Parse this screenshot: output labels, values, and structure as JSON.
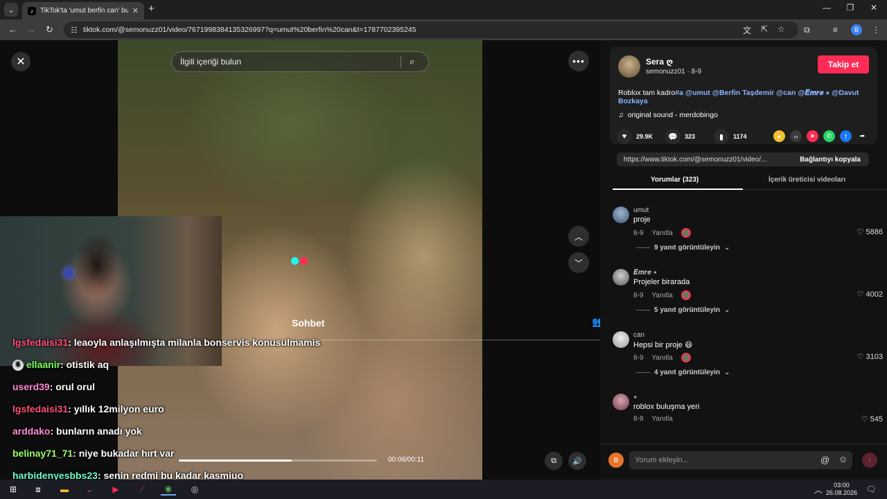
{
  "browser": {
    "tab_title": "TikTok'ta 'umut berfin can' bul...",
    "url": "tiktok.com/@semonuzz01/video/7671998384135326997?q=umut%20berfin%20can&t=1787702395245",
    "profile_initial": "B"
  },
  "player": {
    "search_placeholder": "İlgili içeriği bulun",
    "overlay_label": "Sohbet",
    "time": "00:06/00:11",
    "progress": 0.57
  },
  "chat": [
    {
      "user": "lgsfedaisi31",
      "text": ": leaoyla anlaşılmışta milanla bonservis konusulmamis",
      "color": "#ff4f7b"
    },
    {
      "user": "ellaanir",
      "text": ": otistik aq",
      "color": "#7cff5a",
      "badge": "6"
    },
    {
      "user": "userd39",
      "text": ": orul orul",
      "color": "#ff8ad6"
    },
    {
      "user": "lgsfedaisi31",
      "text": ": yıllık 12milyon euro",
      "color": "#ff4f7b"
    },
    {
      "user": "arddako",
      "text": ": bunların anadı yok",
      "color": "#ff8ad6"
    },
    {
      "user": "belinay71_71",
      "text": ": niye bukadar hırt var",
      "color": "#9cff6a"
    },
    {
      "user": "harbidenyesbbs23",
      "text": ": senin redmi bu kadar kasmiuo",
      "color": "#6affc8"
    }
  ],
  "author": {
    "name": "Sera ღ",
    "handle": "semonuzz01 · 8-9",
    "follow_label": "Takip et",
    "desc_plain": "Roblox tam kadro",
    "desc_tags": "#a @umut @Berfin Taşdemir @can @𝑬𝒎𝒓𝒆 ⭑ @Davut Bozkaya",
    "sound": "original sound - merdobingo"
  },
  "stats": {
    "likes": "29.9K",
    "comments": "323",
    "saves": "1174"
  },
  "share": {
    "link": "https://www.tiktok.com/@semonuzz01/video/...",
    "copy_label": "Bağlantıyı kopyala",
    "colors": [
      "#f2c12e",
      "#3a3a3a",
      "#fe2c55",
      "#25d366",
      "#1877f2"
    ]
  },
  "tabs": {
    "comments": "Yorumlar (323)",
    "creator_videos": "İçerik üreticisi videoları"
  },
  "comments": [
    {
      "name": "umut",
      "text": "proje",
      "date": "8-9",
      "reply": "Yanıtla",
      "likes": "5886",
      "replies": "9 yanıt görüntüleyin"
    },
    {
      "name": "𝑬𝒎𝒓𝒆 ⭑",
      "text": "Projeler birarada",
      "date": "8-9",
      "reply": "Yanıtla",
      "likes": "4002",
      "replies": "5 yanıt görüntüleyin"
    },
    {
      "name": "can",
      "text": "Hepsi bir proje 😄",
      "date": "8-9",
      "reply": "Yanıtla",
      "likes": "3103",
      "replies": "4 yanıt görüntüleyin"
    },
    {
      "name": "⭑",
      "text": "roblox buluşma yeri",
      "date": "8-9",
      "reply": "Yanıtla",
      "likes": "545",
      "replies": ""
    }
  ],
  "comment_input": {
    "placeholder": "Yorum ekleyin...",
    "user_initial": "B"
  },
  "taskbar": {
    "time": "03:00",
    "date": "26.08.2026"
  }
}
